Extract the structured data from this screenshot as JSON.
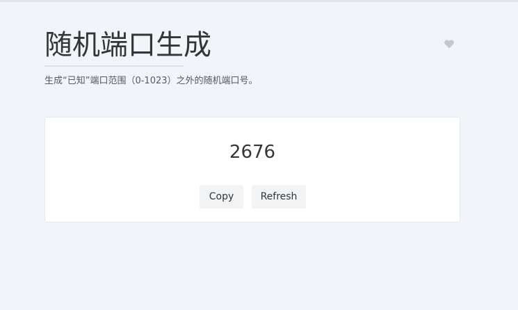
{
  "header": {
    "title": "随机端口生成",
    "description": "生成“已知”端口范围（0-1023）之外的随机端口号。",
    "favorite_icon": "heart-icon"
  },
  "result": {
    "port": "2676",
    "copy_label": "Copy",
    "refresh_label": "Refresh"
  },
  "colors": {
    "background": "#f1f4f8",
    "card": "#ffffff",
    "button": "#f2f3f5",
    "icon": "#c4c7cb"
  }
}
